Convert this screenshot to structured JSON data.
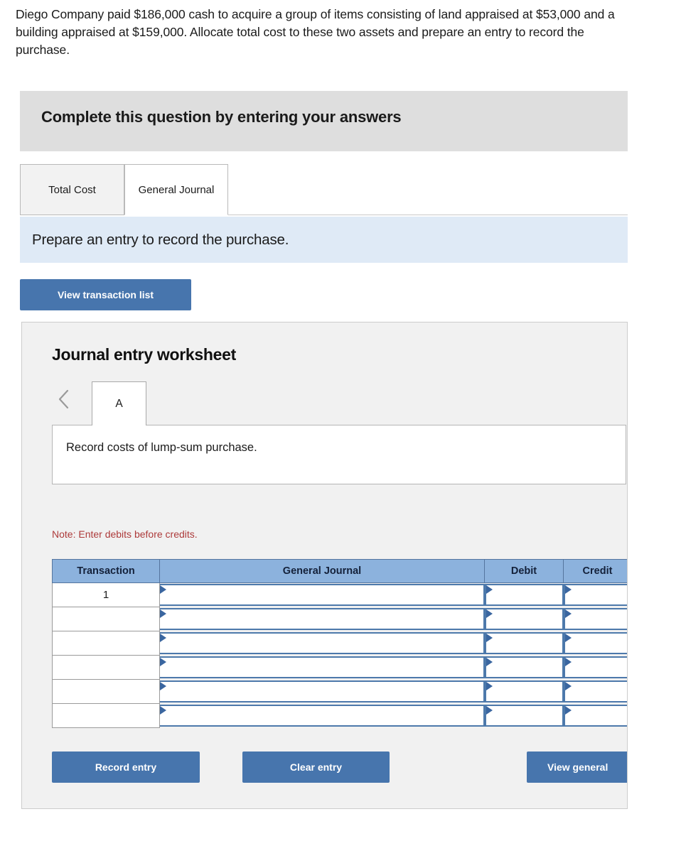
{
  "question": {
    "prompt": "Diego Company paid $186,000 cash to acquire a group of items consisting of land appraised at $53,000 and a building appraised at $159,000. Allocate total cost to these two assets and prepare an entry to record the purchase."
  },
  "banner": {
    "text": "Complete this question by entering your answers"
  },
  "tabs": [
    {
      "label": "Total Cost",
      "active": false
    },
    {
      "label": "General Journal",
      "active": true
    }
  ],
  "instruction": {
    "text": "Prepare an entry to record the purchase."
  },
  "actions": {
    "view_transaction_list": "View transaction list",
    "record_entry": "Record entry",
    "clear_entry": "Clear entry",
    "view_general_journal": "View general"
  },
  "worksheet": {
    "title": "Journal entry worksheet",
    "prev_icon": "chevron-left-icon",
    "entry_tabs": [
      {
        "label": "A",
        "active": true
      }
    ],
    "description": "Record costs of lump-sum purchase.",
    "note": "Note: Enter debits before credits."
  },
  "journal_table": {
    "columns": [
      "Transaction",
      "General Journal",
      "Debit",
      "Credit"
    ],
    "rows": [
      {
        "transaction": "1",
        "general_journal": "",
        "debit": "",
        "credit": ""
      },
      {
        "transaction": "",
        "general_journal": "",
        "debit": "",
        "credit": ""
      },
      {
        "transaction": "",
        "general_journal": "",
        "debit": "",
        "credit": ""
      },
      {
        "transaction": "",
        "general_journal": "",
        "debit": "",
        "credit": ""
      },
      {
        "transaction": "",
        "general_journal": "",
        "debit": "",
        "credit": ""
      },
      {
        "transaction": "",
        "general_journal": "",
        "debit": "",
        "credit": ""
      }
    ]
  },
  "colors": {
    "banner_gray": "#dedede",
    "instruction_blue": "#dfeaf6",
    "button_blue": "#4775ad",
    "table_header_blue": "#8cb2dd",
    "note_red": "#ad3a3a",
    "panel_gray": "#f1f1f1",
    "input_border_blue": "#4d79ab"
  }
}
